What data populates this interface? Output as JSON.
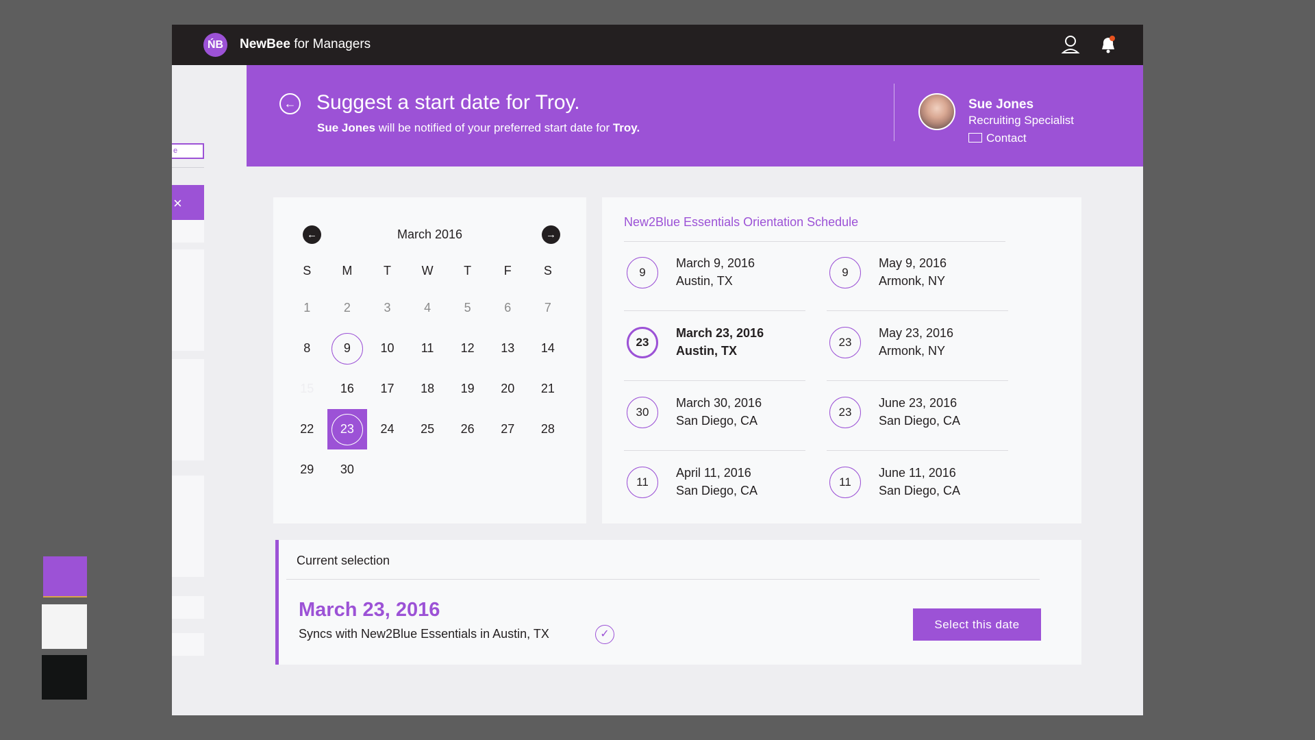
{
  "app": {
    "brand_bold": "NewBee",
    "brand_rest": " for Managers",
    "logo_glyph": "ŃB"
  },
  "sidebar": {
    "input_text": "e",
    "close_glyph": "×"
  },
  "hero": {
    "back_glyph": "←",
    "title": "Suggest a start date for Troy.",
    "sub_name": "Sue Jones",
    "sub_middle": " will be notified of your preferred start date for ",
    "sub_target": "Troy."
  },
  "recruiter": {
    "name": "Sue Jones",
    "role": "Recruiting Specialist",
    "contact_label": "Contact"
  },
  "calendar": {
    "month": "March 2016",
    "prev_glyph": "←",
    "next_glyph": "→",
    "weekdays": [
      "S",
      "M",
      "T",
      "W",
      "T",
      "F",
      "S"
    ],
    "weeks": [
      [
        "1",
        "2",
        "3",
        "4",
        "5",
        "6",
        "7"
      ],
      [
        "8",
        "9",
        "10",
        "11",
        "12",
        "13",
        "14"
      ],
      [
        "15",
        "16",
        "17",
        "18",
        "19",
        "20",
        "21"
      ],
      [
        "22",
        "23",
        "24",
        "25",
        "26",
        "27",
        "28"
      ],
      [
        "29",
        "30",
        "",
        "",
        "",
        "",
        ""
      ]
    ]
  },
  "schedule": {
    "title": "New2Blue Essentials Orientation Schedule",
    "items": [
      {
        "day": "9",
        "date": "March 9, 2016",
        "location": "Austin, TX"
      },
      {
        "day": "9",
        "date": "May 9, 2016",
        "location": "Armonk, NY"
      },
      {
        "day": "23",
        "date": "March 23, 2016",
        "location": "Austin, TX"
      },
      {
        "day": "23",
        "date": "May 23, 2016",
        "location": "Armonk, NY"
      },
      {
        "day": "30",
        "date": "March 30, 2016",
        "location": "San Diego, CA"
      },
      {
        "day": "23",
        "date": "June 23, 2016",
        "location": "San Diego, CA"
      },
      {
        "day": "11",
        "date": "April 11, 2016",
        "location": "San Diego, CA"
      },
      {
        "day": "11",
        "date": "June 11, 2016",
        "location": "San Diego, CA"
      }
    ]
  },
  "current": {
    "label": "Current selection",
    "date": "March 23, 2016",
    "sync_text": "Syncs with New2Blue Essentials in Austin, TX",
    "check_glyph": "✓",
    "button_label": "Select this date"
  },
  "colors": {
    "accent": "#9c52d6",
    "topbar": "#231f20",
    "background": "#eeeef1",
    "card": "#f8f9fa"
  },
  "icons": {
    "user": "user-icon",
    "notifications": "bell-icon",
    "contact": "envelope-icon",
    "back": "back-arrow-icon",
    "check": "check-circle-icon"
  }
}
